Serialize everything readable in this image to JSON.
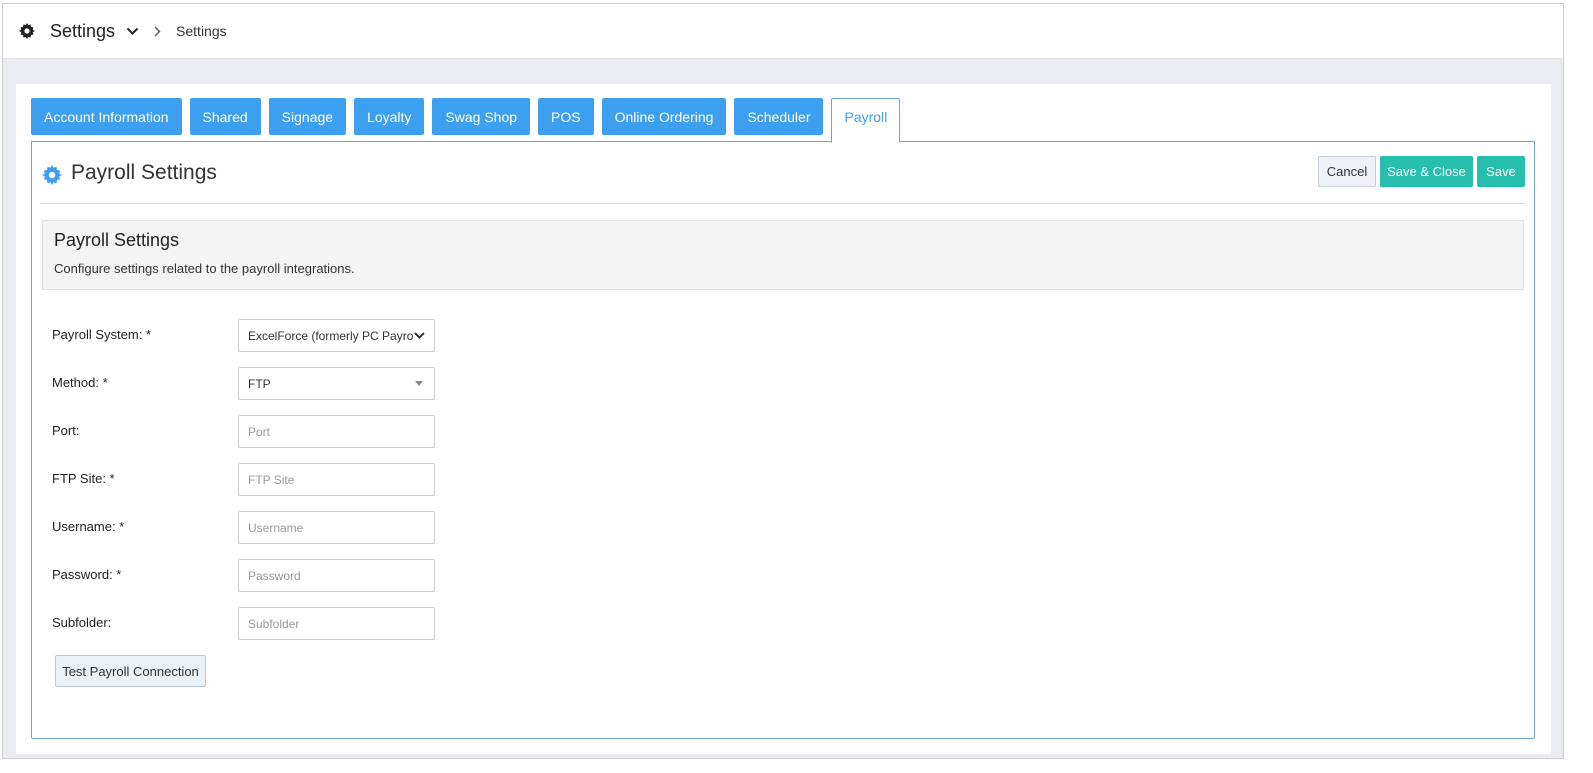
{
  "topbar": {
    "title": "Settings",
    "breadcrumb": "Settings"
  },
  "tabs": [
    {
      "label": "Account Information"
    },
    {
      "label": "Shared"
    },
    {
      "label": "Signage"
    },
    {
      "label": "Loyalty"
    },
    {
      "label": "Swag Shop"
    },
    {
      "label": "POS"
    },
    {
      "label": "Online Ordering"
    },
    {
      "label": "Scheduler"
    },
    {
      "label": "Payroll",
      "active": true
    }
  ],
  "panel": {
    "title": "Payroll Settings",
    "cancel_label": "Cancel",
    "save_close_label": "Save & Close",
    "save_label": "Save"
  },
  "info": {
    "heading": "Payroll Settings",
    "description": "Configure settings related to the payroll integrations."
  },
  "form": {
    "payroll_system": {
      "label": "Payroll System: *",
      "value": "ExcelForce (formerly PC Payroll)"
    },
    "method": {
      "label": "Method: *",
      "value": "FTP"
    },
    "port": {
      "label": "Port:",
      "placeholder": "Port"
    },
    "ftp_site": {
      "label": "FTP Site: *",
      "placeholder": "FTP Site"
    },
    "username": {
      "label": "Username: *",
      "placeholder": "Username"
    },
    "password": {
      "label": "Password: *",
      "placeholder": "Password"
    },
    "subfolder": {
      "label": "Subfolder:",
      "placeholder": "Subfolder"
    },
    "test_button": "Test Payroll Connection"
  },
  "colors": {
    "tab_blue": "#3d9ff0",
    "teal": "#26bfae",
    "panel_border": "#6ca6c8"
  }
}
